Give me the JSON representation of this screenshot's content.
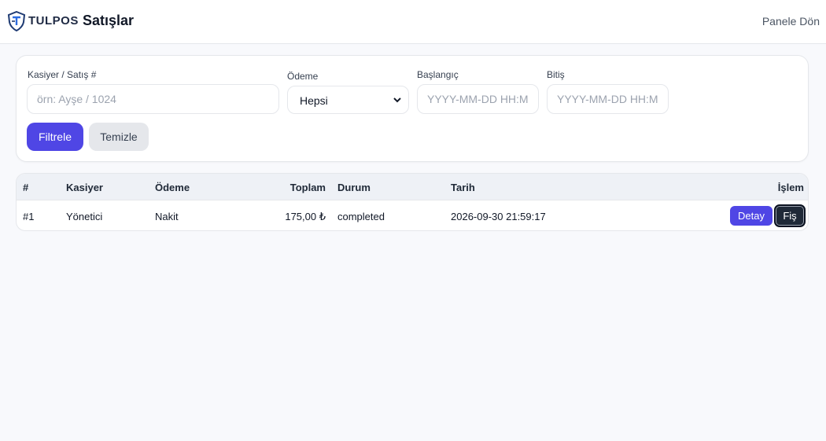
{
  "header": {
    "brand": "TULPOS",
    "title": "Satışlar",
    "back_link": "Panele Dön"
  },
  "filters": {
    "cashier_label": "Kasiyer / Satış #",
    "cashier_placeholder": "örn: Ayşe / 1024",
    "payment_label": "Ödeme",
    "payment_selected": "Hepsi",
    "start_label": "Başlangıç",
    "start_placeholder": "YYYY-MM-DD HH:MM",
    "end_label": "Bitiş",
    "end_placeholder": "YYYY-MM-DD HH:MM",
    "filter_button": "Filtrele",
    "clear_button": "Temizle"
  },
  "table": {
    "columns": {
      "id": "#",
      "cashier": "Kasiyer",
      "payment": "Ödeme",
      "total": "Toplam",
      "status": "Durum",
      "date": "Tarih",
      "action": "İşlem"
    },
    "rows": [
      {
        "id": "#1",
        "cashier": "Yönetici",
        "payment": "Nakit",
        "total": "175,00 ₺",
        "status": "completed",
        "date": "2026-09-30 21:59:17",
        "detail_button": "Detay",
        "receipt_button": "Fiş"
      }
    ]
  },
  "colors": {
    "accent": "#4f46e5",
    "dark_button": "#1f2937",
    "background": "#f8f9fc"
  },
  "icons": {
    "logo": "tulpos-shield-logo",
    "select_arrow": "chevron-down-icon"
  }
}
